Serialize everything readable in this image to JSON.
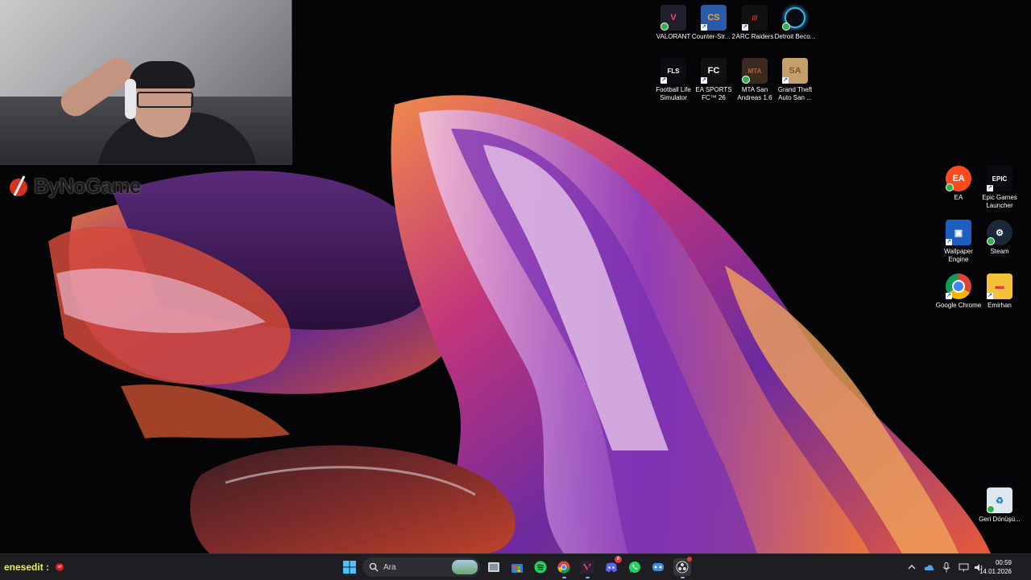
{
  "webcam": {
    "description_name": "streamer-webcam"
  },
  "brand": {
    "text": "ByNoGame"
  },
  "desktop": {
    "icons_top": [
      {
        "label": "VALORANT",
        "icon": "valorant-icon",
        "color": "#1f1f2e",
        "accent": "#ff4655"
      },
      {
        "label": "Counter-Str... 2",
        "icon": "counter-strike-icon",
        "color": "#2a5aa8",
        "accent": "#f3a33c"
      },
      {
        "label": "ARC Raiders",
        "icon": "arc-raiders-icon",
        "color": "#111111",
        "accent": "#e23b3b"
      },
      {
        "label": "Detroit Beco...",
        "icon": "detroit-icon",
        "color": "#0b0b12",
        "accent": "#39b5e6"
      },
      {
        "label": "Football Life Simulator",
        "icon": "football-life-icon",
        "color": "#0b0b10",
        "accent": "#ffffff"
      },
      {
        "label": "EA SPORTS FC™ 26",
        "icon": "ea-fc-icon",
        "color": "#111111",
        "accent": "#ffffff"
      },
      {
        "label": "MTA San Andreas 1.6",
        "icon": "mta-icon",
        "color": "#3a2a20",
        "accent": "#c75a2a"
      },
      {
        "label": "Grand Theft Auto San ...",
        "icon": "gta-icon",
        "color": "#c6a06a",
        "accent": "#7a5530"
      }
    ],
    "icons_right": [
      {
        "label": "EA",
        "icon": "ea-icon",
        "color": "#ff4a1c",
        "accent": "#ffffff"
      },
      {
        "label": "Epic Games Launcher",
        "icon": "epic-games-icon",
        "color": "#0b0b0f",
        "accent": "#ffffff"
      },
      {
        "label": "Wallpaper Engine",
        "icon": "wallpaper-engine-icon",
        "color": "#1d5fc0",
        "accent": "#ffffff"
      },
      {
        "label": "Steam",
        "icon": "steam-icon",
        "color": "#1b2838",
        "accent": "#ffffff"
      },
      {
        "label": "Google Chrome",
        "icon": "chrome-icon",
        "color": "#ffffff",
        "accent": "#db4437"
      },
      {
        "label": "Emirhan",
        "icon": "folder-icon",
        "color": "#f3c13a",
        "accent": "#e23b3b"
      },
      {
        "label": "Geri Dönüşü...",
        "icon": "recycle-bin-icon",
        "color": "#dfe7ee",
        "accent": "#2e7ad8"
      }
    ]
  },
  "taskbar": {
    "user_label": "enesedit :",
    "user_badge": "sıf",
    "search": {
      "placeholder": "Ara"
    },
    "apps": [
      {
        "name": "start-button",
        "icon": "windows-icon"
      },
      {
        "name": "task-view",
        "icon": "task-view-icon"
      },
      {
        "name": "microsoft-store",
        "icon": "store-icon"
      },
      {
        "name": "spotify",
        "icon": "spotify-icon"
      },
      {
        "name": "chrome",
        "icon": "chrome-icon"
      },
      {
        "name": "valorant",
        "icon": "valorant-icon"
      },
      {
        "name": "discord",
        "icon": "discord-icon",
        "badge": "8"
      },
      {
        "name": "whatsapp",
        "icon": "whatsapp-icon"
      },
      {
        "name": "steam-like",
        "icon": "gamepad-icon"
      },
      {
        "name": "obs",
        "icon": "obs-icon"
      }
    ],
    "tray": {
      "time": "00:59",
      "date": "14.01.2026"
    }
  },
  "colors": {
    "taskbar_bg": "#1e1e22",
    "user_label": "#e9f24b",
    "accent": "#8ab4f8"
  }
}
